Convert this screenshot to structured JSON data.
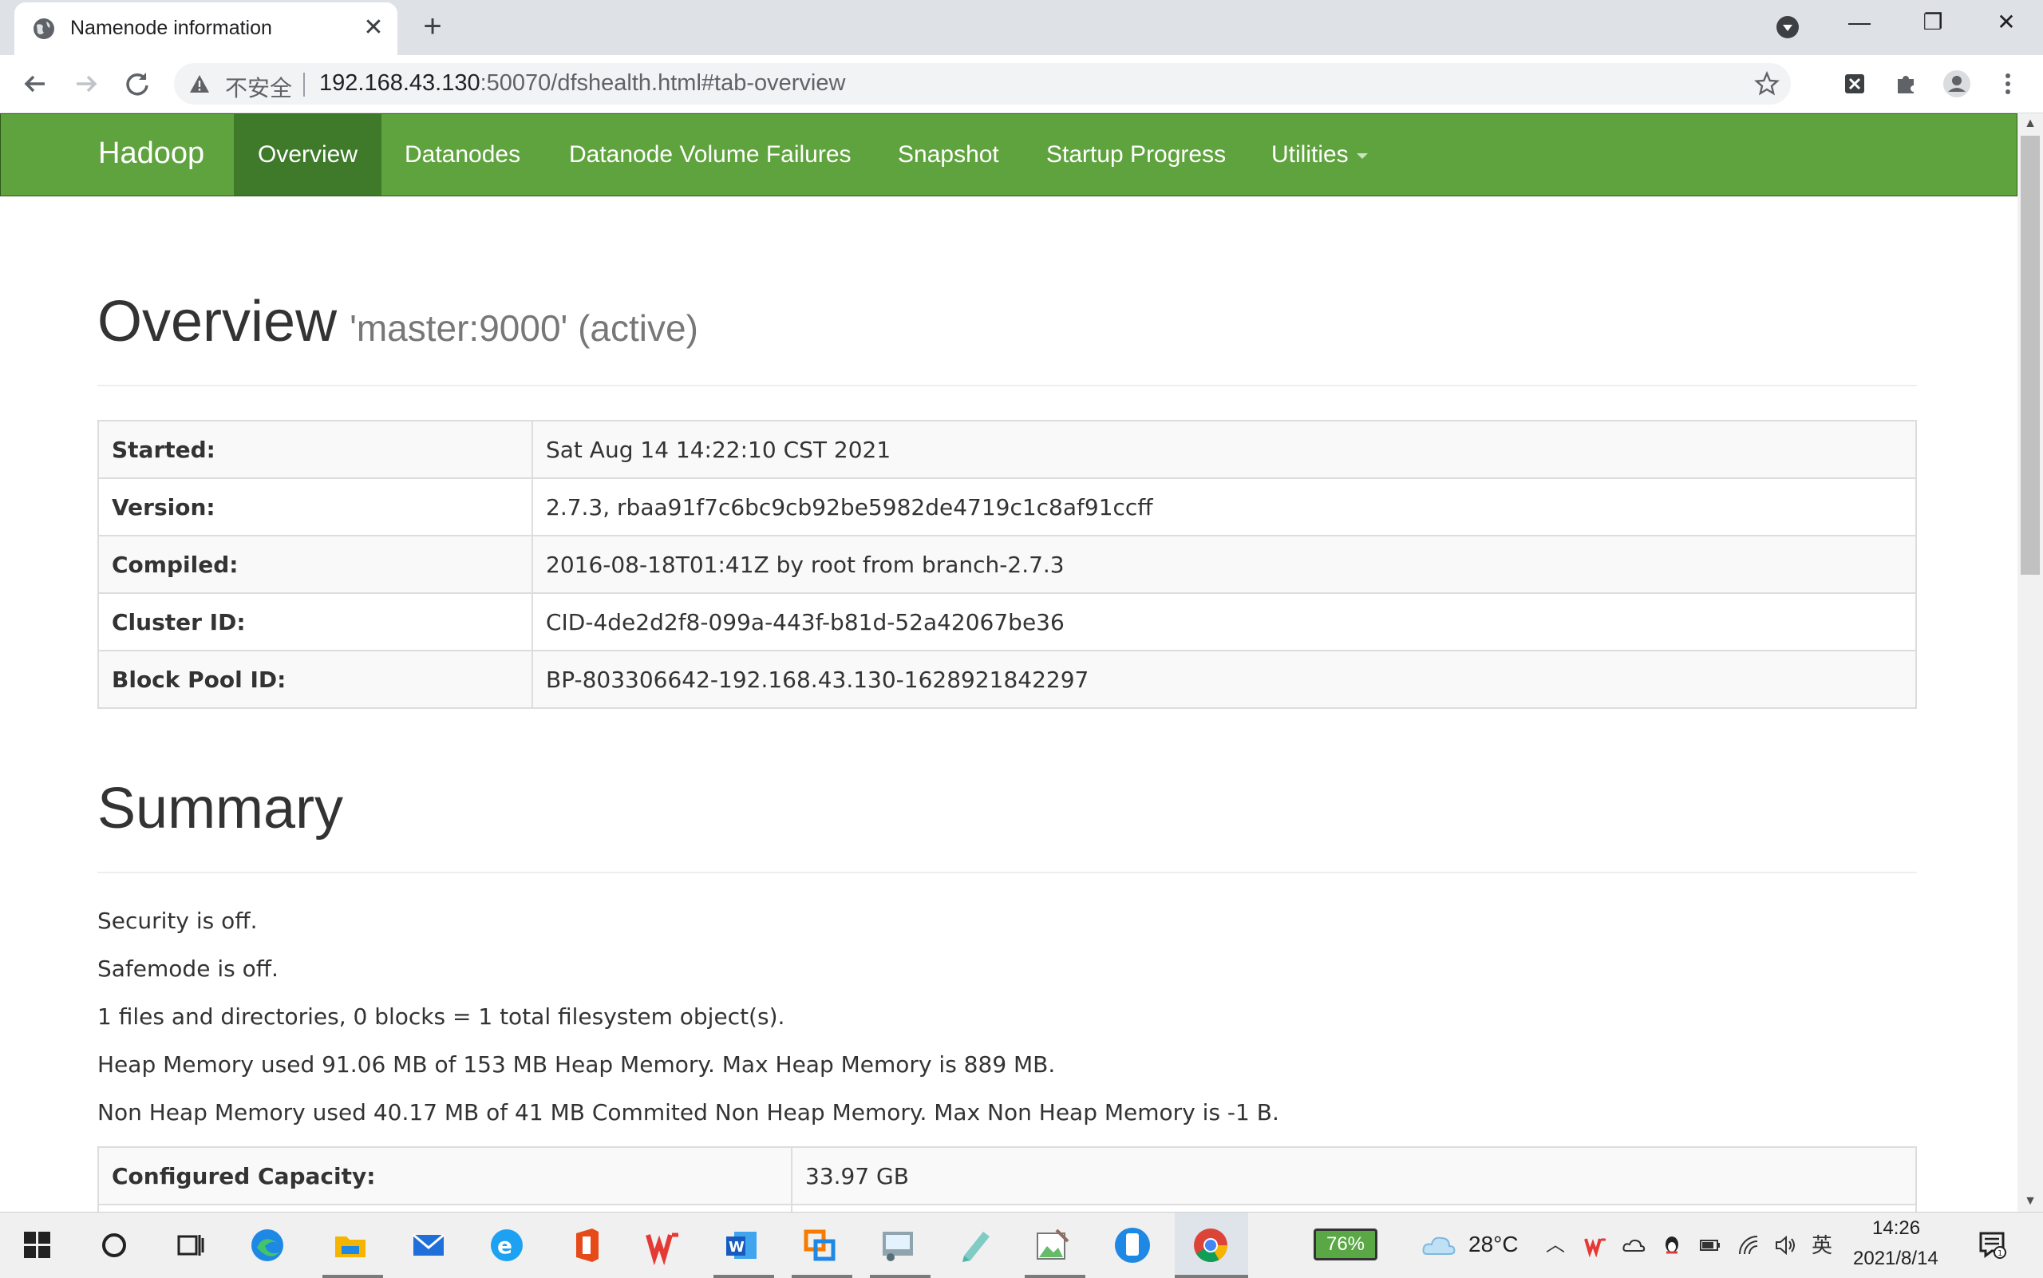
{
  "browser": {
    "tab_title": "Namenode information",
    "tab_close": "✕",
    "new_tab": "+",
    "insecure_label": "不安全",
    "url_host": "192.168.43.130",
    "url_rest": ":50070/dfshealth.html#tab-overview",
    "window_minimize": "—",
    "window_restore": "❐",
    "window_close": "✕"
  },
  "navbar": {
    "brand": "Hadoop",
    "items": [
      {
        "label": "Overview"
      },
      {
        "label": "Datanodes"
      },
      {
        "label": "Datanode Volume Failures"
      },
      {
        "label": "Snapshot"
      },
      {
        "label": "Startup Progress"
      },
      {
        "label": "Utilities"
      }
    ],
    "active": "Overview"
  },
  "overview": {
    "title": "Overview",
    "subtitle": "'master:9000' (active)",
    "rows": [
      {
        "key": "Started:",
        "value": "Sat Aug 14 14:22:10 CST 2021"
      },
      {
        "key": "Version:",
        "value": "2.7.3, rbaa91f7c6bc9cb92be5982de4719c1c8af91ccff"
      },
      {
        "key": "Compiled:",
        "value": "2016-08-18T01:41Z by root from branch-2.7.3"
      },
      {
        "key": "Cluster ID:",
        "value": "CID-4de2d2f8-099a-443f-b81d-52a42067be36"
      },
      {
        "key": "Block Pool ID:",
        "value": "BP-803306642-192.168.43.130-1628921842297"
      }
    ]
  },
  "summary": {
    "title": "Summary",
    "lines": [
      "Security is off.",
      "Safemode is off.",
      "1 files and directories, 0 blocks = 1 total filesystem object(s).",
      "Heap Memory used 91.06 MB of 153 MB Heap Memory. Max Heap Memory is 889 MB.",
      "Non Heap Memory used 40.17 MB of 41 MB Commited Non Heap Memory. Max Non Heap Memory is -1 B."
    ],
    "capacity": {
      "key": "Configured Capacity:",
      "value": "33.97 GB"
    }
  },
  "taskbar": {
    "battery": "76%",
    "weather": "28°C",
    "ime": "英",
    "time": "14:26",
    "date": "2021/8/14"
  },
  "colors": {
    "navbar_bg": "#5fa33e",
    "navbar_active": "#3e7a2a"
  }
}
